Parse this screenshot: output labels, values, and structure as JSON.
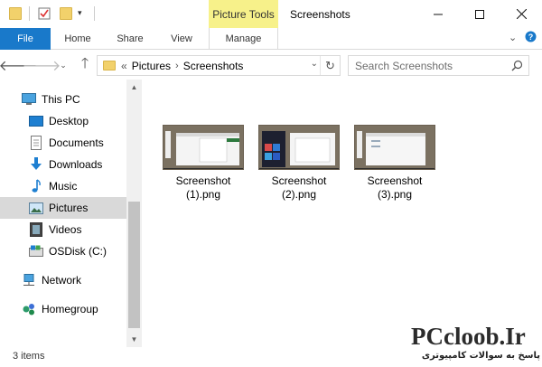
{
  "window": {
    "title": "Screenshots",
    "contextual_tab": "Picture Tools"
  },
  "ribbon": {
    "tabs": [
      "File",
      "Home",
      "Share",
      "View",
      "Manage"
    ]
  },
  "address": {
    "overflow": "«",
    "crumbs": [
      "Pictures",
      "Screenshots"
    ]
  },
  "search": {
    "placeholder": "Search Screenshots"
  },
  "nav": {
    "items": [
      {
        "label": "This PC",
        "icon": "computer-icon"
      },
      {
        "label": "Desktop",
        "icon": "desktop-icon"
      },
      {
        "label": "Documents",
        "icon": "documents-icon"
      },
      {
        "label": "Downloads",
        "icon": "downloads-icon"
      },
      {
        "label": "Music",
        "icon": "music-icon"
      },
      {
        "label": "Pictures",
        "icon": "pictures-icon",
        "selected": true
      },
      {
        "label": "Videos",
        "icon": "videos-icon"
      },
      {
        "label": "OSDisk (C:)",
        "icon": "disk-icon"
      },
      {
        "label": "Network",
        "icon": "network-icon"
      },
      {
        "label": "Homegroup",
        "icon": "homegroup-icon"
      }
    ]
  },
  "files": [
    {
      "name_line1": "Screenshot",
      "name_line2": "(1).png"
    },
    {
      "name_line1": "Screenshot",
      "name_line2": "(2).png"
    },
    {
      "name_line1": "Screenshot",
      "name_line2": "(3).png"
    }
  ],
  "status": {
    "items_text": "3 items"
  },
  "watermark": {
    "main": "PCcloob.Ir",
    "sub": "پاسخ به سوالات کامپیوتری"
  },
  "colors": {
    "file_tab": "#1979ca",
    "contextual_tab": "#f7f18a",
    "selected_nav": "#d9d9d9"
  }
}
